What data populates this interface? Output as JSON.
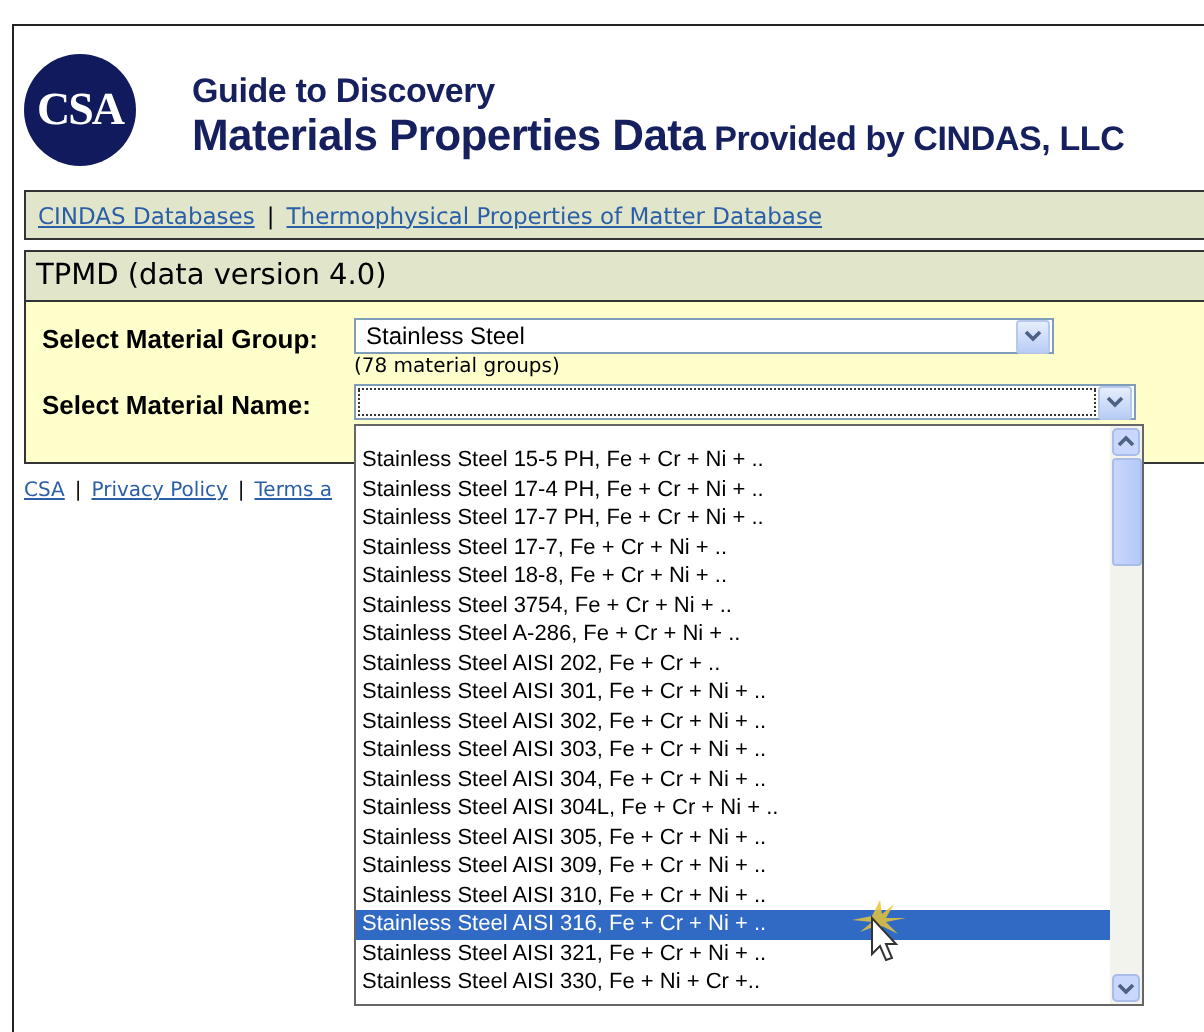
{
  "header": {
    "logo": "CSA",
    "tagline": "Guide to Discovery",
    "title": "Materials Properties Data",
    "subtitle": "Provided by CINDAS, LLC"
  },
  "nav": {
    "links": [
      "CINDAS Databases",
      "Thermophysical Properties of Matter Database"
    ],
    "separator": "|"
  },
  "panel": {
    "title": "TPMD (data version 4.0)",
    "group": {
      "label": "Select Material Group:",
      "value": "Stainless Steel",
      "note": "(78 material groups)"
    },
    "name": {
      "label": "Select Material Name:",
      "expanded": true,
      "options": [
        {
          "label": "Stainless Steel 15-5 PH, Fe + Cr + Ni + ..",
          "selected": false
        },
        {
          "label": "Stainless Steel 17-4 PH, Fe + Cr + Ni + ..",
          "selected": false
        },
        {
          "label": "Stainless Steel 17-7 PH, Fe + Cr + Ni + ..",
          "selected": false
        },
        {
          "label": "Stainless Steel 17-7, Fe + Cr + Ni + ..",
          "selected": false
        },
        {
          "label": "Stainless Steel 18-8, Fe + Cr + Ni + ..",
          "selected": false
        },
        {
          "label": "Stainless Steel 3754, Fe + Cr + Ni + ..",
          "selected": false
        },
        {
          "label": "Stainless Steel A-286, Fe + Cr + Ni + ..",
          "selected": false
        },
        {
          "label": "Stainless Steel AISI 202, Fe + Cr + ..",
          "selected": false
        },
        {
          "label": "Stainless Steel AISI 301, Fe + Cr + Ni + ..",
          "selected": false
        },
        {
          "label": "Stainless Steel AISI 302, Fe + Cr + Ni + ..",
          "selected": false
        },
        {
          "label": "Stainless Steel AISI 303, Fe + Cr + Ni + ..",
          "selected": false
        },
        {
          "label": "Stainless Steel AISI 304, Fe + Cr + Ni + ..",
          "selected": false
        },
        {
          "label": "Stainless Steel AISI 304L, Fe + Cr + Ni + ..",
          "selected": false
        },
        {
          "label": "Stainless Steel AISI 305, Fe + Cr + Ni + ..",
          "selected": false
        },
        {
          "label": "Stainless Steel AISI 309, Fe + Cr + Ni + ..",
          "selected": false
        },
        {
          "label": "Stainless Steel AISI 310, Fe + Cr + Ni + ..",
          "selected": false
        },
        {
          "label": "Stainless Steel AISI 316, Fe + Cr + Ni + ..",
          "selected": true
        },
        {
          "label": "Stainless Steel AISI 321, Fe + Cr + Ni + ..",
          "selected": false
        },
        {
          "label": "Stainless Steel AISI 330, Fe + Ni + Cr +..",
          "selected": false
        }
      ]
    }
  },
  "footer": {
    "links": [
      "CSA",
      "Privacy Policy",
      "Terms a"
    ],
    "separator": "|"
  }
}
